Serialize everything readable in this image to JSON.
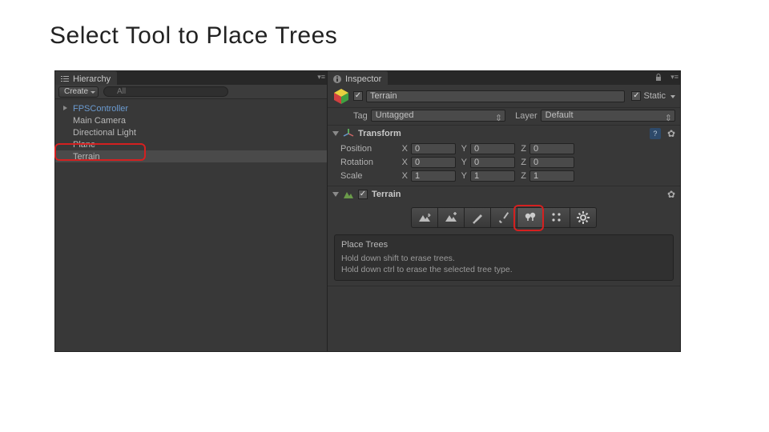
{
  "slide": {
    "title": "Select Tool to Place Trees"
  },
  "hierarchy": {
    "tab_label": "Hierarchy",
    "create_label": "Create",
    "search_placeholder": "All",
    "items": [
      {
        "label": "FPSController",
        "prefab": true,
        "expandable": true
      },
      {
        "label": "Main Camera"
      },
      {
        "label": "Directional Light"
      },
      {
        "label": "Plane"
      },
      {
        "label": "Terrain",
        "selected": true
      }
    ]
  },
  "inspector": {
    "tab_label": "Inspector",
    "object_name": "Terrain",
    "enabled": true,
    "static_label": "Static",
    "static_checked": true,
    "tag_label": "Tag",
    "tag_value": "Untagged",
    "layer_label": "Layer",
    "layer_value": "Default",
    "transform": {
      "title": "Transform",
      "rows": [
        {
          "label": "Position",
          "x": "0",
          "y": "0",
          "z": "0"
        },
        {
          "label": "Rotation",
          "x": "0",
          "y": "0",
          "z": "0"
        },
        {
          "label": "Scale",
          "x": "1",
          "y": "1",
          "z": "1"
        }
      ]
    },
    "terrain": {
      "title": "Terrain",
      "enabled": true,
      "tools": [
        "raise-lower",
        "paint-height",
        "smooth-height",
        "paint-texture",
        "place-trees",
        "paint-details",
        "settings"
      ],
      "active_tool_index": 4,
      "help": {
        "title": "Place Trees",
        "line1": "Hold down shift to erase trees.",
        "line2": "Hold down ctrl to erase the selected tree type."
      }
    }
  }
}
